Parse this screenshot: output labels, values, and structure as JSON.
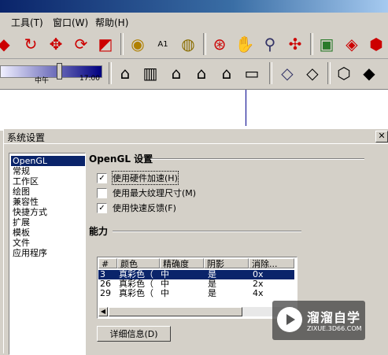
{
  "menubar": {
    "items": [
      "工具(T)",
      "窗口(W)",
      "帮助(H)"
    ]
  },
  "toolbar1": {
    "icons": [
      "push-pull-icon",
      "follow-me-icon",
      "move-icon",
      "rotate-icon",
      "scale-icon",
      "tape-measure-icon",
      "text-tool-icon",
      "paint-bucket-icon",
      "orbit-icon",
      "pan-icon",
      "zoom-icon",
      "zoom-extents-icon",
      "get-models-icon",
      "share-model-icon",
      "warehouse-icon"
    ]
  },
  "toolbar2": {
    "sun_left_label": "中午",
    "sun_right_label": "17:00",
    "sun_position": 0.57,
    "view_icons": [
      "iso-view-icon",
      "top-view-icon",
      "front-view-icon",
      "right-view-icon",
      "back-view-icon",
      "left-view-icon"
    ],
    "style_icons": [
      "xray-icon",
      "wireframe-icon",
      "hidden-line-icon",
      "shaded-icon"
    ]
  },
  "dialog": {
    "title": "系统设置",
    "close_glyph": "✕",
    "categories": [
      "OpenGL",
      "常规",
      "工作区",
      "绘图",
      "兼容性",
      "快捷方式",
      "扩展",
      "模板",
      "文件",
      "应用程序"
    ],
    "selected_category": "OpenGL",
    "opengl_title": "OpenGL 设置",
    "options": [
      {
        "label": "使用硬件加速(H)",
        "checked": true,
        "glyph": "✓"
      },
      {
        "label": "使用最大纹理尺寸(M)",
        "checked": false,
        "glyph": ""
      },
      {
        "label": "使用快速反馈(F)",
        "checked": true,
        "glyph": "✓"
      }
    ],
    "capability_title": "能力",
    "table": {
      "columns": [
        "#",
        "颜色",
        "精确度",
        "阴影",
        "消除..."
      ],
      "rows": [
        [
          "3",
          "真彩色（",
          "中",
          "是",
          "0x"
        ],
        [
          "26",
          "真彩色（",
          "中",
          "是",
          "2x"
        ],
        [
          "29",
          "真彩色（",
          "中",
          "是",
          "4x"
        ]
      ],
      "selected_row": 0
    },
    "scroll_left_glyph": "◀",
    "scroll_right_glyph": "▶",
    "detail_button": "详细信息(D)"
  },
  "watermark": {
    "name": "溜溜自学",
    "url": "ZIXUE.3D66.COM"
  },
  "colors": {
    "selection": "#0a246a",
    "chrome": "#d4d0c8",
    "axis": "#00008b"
  }
}
